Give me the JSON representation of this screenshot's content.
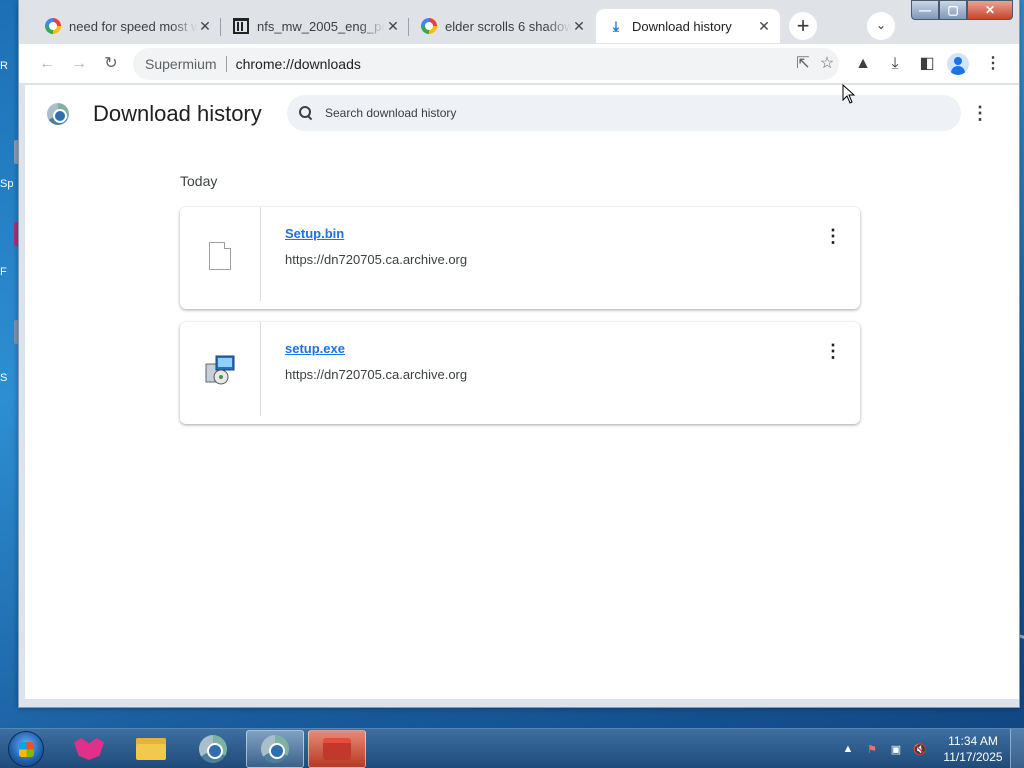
{
  "desktop": {
    "fragments": [
      "R",
      "Sp",
      "F",
      "S"
    ]
  },
  "tabs": [
    {
      "title": "need for speed most w",
      "icon": "google-favicon"
    },
    {
      "title": "nfs_mw_2005_eng_pc_",
      "icon": "archive-org-favicon"
    },
    {
      "title": "elder scrolls 6 shadow",
      "icon": "google-favicon"
    },
    {
      "title": "Download history",
      "icon": "download-favicon",
      "active": true
    }
  ],
  "tab_close_glyph": "✕",
  "newtab_glyph": "+",
  "tabsearch_glyph": "⌄",
  "window_controls": {
    "minimize": "—",
    "maximize": "▢",
    "close": "✕"
  },
  "toolbar": {
    "back": "←",
    "forward": "→",
    "reload": "↻",
    "site_label": "Supermium",
    "url": "chrome://downloads",
    "share": "⇱",
    "bookmark": "☆",
    "labs": "▲",
    "downloads": "⤓",
    "sidepanel": "◧",
    "menu": "⋮"
  },
  "page": {
    "title": "Download history",
    "search_placeholder": "Search download history",
    "menu": "⋮",
    "section_date": "Today",
    "downloads": [
      {
        "name": "Setup.bin",
        "url": "https://dn720705.ca.archive.org",
        "icon": "generic-file-icon",
        "more": "⋮"
      },
      {
        "name": "setup.exe",
        "url": "https://dn720705.ca.archive.org",
        "icon": "installer-icon",
        "more": "⋮"
      }
    ]
  },
  "taskbar": {
    "apps": [
      "fox-app-icon",
      "file-explorer-icon",
      "chromium-icon",
      "supermium-icon",
      "toolbox-icon"
    ],
    "tray": {
      "expand": "▲",
      "flag": "⚑",
      "network": "▣",
      "volume": "🔇"
    },
    "time": "11:34 AM",
    "date": "11/17/2025"
  },
  "colors": {
    "accent": "#1a73e8",
    "tabstrip": "#dfe3e8",
    "search_bg": "#eef1f6"
  }
}
